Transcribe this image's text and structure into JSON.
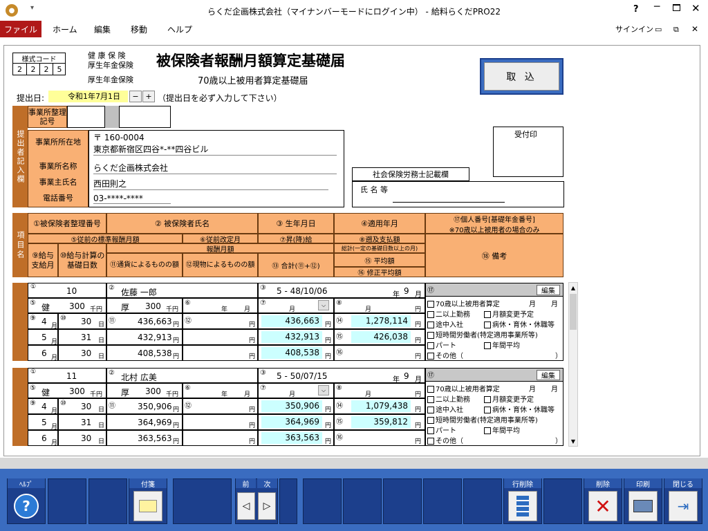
{
  "window": {
    "title": "らくだ企画株式会社（マイナンバーモードにログイン中） - 給料らくだPRO22",
    "signin": "サインイン",
    "help_btn": "?"
  },
  "menu": {
    "file": "ファイル",
    "home": "ホーム",
    "edit": "編集",
    "move": "移動",
    "help": "ヘルプ"
  },
  "form": {
    "format_code_label": "様式コード",
    "format_code": [
      "2",
      "2",
      "2",
      "5"
    ],
    "ins_types": [
      "健 康 保 険",
      "厚生年金保険",
      "厚生年金保険"
    ],
    "title": "被保険者報酬月額算定基礎届",
    "subtitle": "70歳以上被用者算定基礎届",
    "import_btn": "取 込",
    "submit_label": "提出日:",
    "submit_date": "令和1年7月1日",
    "minus": "−",
    "plus": "+",
    "submit_note": "（提出日を必ず入力して下さい）",
    "sidebar_text": "提出者記入欄",
    "office_id_label": "事業所整理記号",
    "addr_label": "事業所所在地",
    "zip": "〒 160-0004",
    "address": "東京都新宿区四谷*-**四谷ビル",
    "name_label": "事業所名称",
    "company": "らくだ企画株式会社",
    "owner_label": "事業主氏名",
    "owner": "西田則之",
    "phone_label": "電話番号",
    "phone": "03-****-****",
    "receipt_label": "受付印",
    "sharoushi_label": "社会保険労務士記載欄",
    "sharoushi_name": "氏 名 等"
  },
  "header": {
    "side": "項目名",
    "h1": "①被保険者整理番号",
    "h2": "② 被保険者氏名",
    "h3": "③ 生年月日",
    "h4": "④適用年月",
    "h17": "⑰個人番号[基礎年金番号]",
    "h17b": "※70歳以上被用者の場合のみ",
    "h5": "⑤従前の標準報酬月額",
    "h6": "⑥従前改定月",
    "h7": "⑦昇(降)給",
    "h8": "⑧遡及支払額",
    "h9": "⑨給与支給月",
    "h10": "⑩給与計算の基礎日数",
    "hpay": "報酬月額",
    "h11": "⑪通貨によるものの額",
    "h12": "⑫現物によるものの額",
    "h13": "⑬ 合計(⑪+⑫)",
    "h14": "総計(一定の基礎日数以上の月)",
    "h15": "⑮ 平均額",
    "h16": "⑯ 修正平均額",
    "h18": "⑱ 備考"
  },
  "employees": [
    {
      "no": "10",
      "name": "佐藤 一郎",
      "birth": "5 - 48/10/06",
      "apply_year": "年",
      "apply_month": "9",
      "edit": "編集",
      "ken": "健",
      "ken_val": "300",
      "kou": "厚",
      "kou_val": "300",
      "sen": "千円",
      "months": [
        {
          "m": "4",
          "d": "30",
          "cur": "436,663",
          "total": "436,663"
        },
        {
          "m": "5",
          "d": "31",
          "cur": "432,913",
          "total": "432,913"
        },
        {
          "m": "6",
          "d": "30",
          "cur": "408,538",
          "total": "408,538"
        }
      ],
      "sum": "1,278,114",
      "avg": "426,038"
    },
    {
      "no": "11",
      "name": "北村 広美",
      "birth": "5 - 50/07/15",
      "apply_year": "年",
      "apply_month": "9",
      "edit": "編集",
      "ken": "健",
      "ken_val": "300",
      "kou": "厚",
      "kou_val": "300",
      "sen": "千円",
      "months": [
        {
          "m": "4",
          "d": "30",
          "cur": "350,906",
          "total": "350,906"
        },
        {
          "m": "5",
          "d": "31",
          "cur": "364,969",
          "total": "364,969"
        },
        {
          "m": "6",
          "d": "30",
          "cur": "363,563",
          "total": "363,563"
        }
      ],
      "sum": "1,079,438",
      "avg": "359,812"
    }
  ],
  "remarks": {
    "r1": "70歳以上被用者算定",
    "r1b": "月",
    "r1c": "月",
    "r2": "二以上勤務",
    "r3": "月額変更予定",
    "r4": "途中入社",
    "r5": "病休・育休・休職等",
    "r6": "短時間労働者(特定適用事業所等)",
    "r7": "パート",
    "r8": "年間平均",
    "r9": "その他（",
    "r9b": "）"
  },
  "units": {
    "year": "年",
    "month": "月",
    "yen": "円",
    "day": "日",
    "circ": [
      "①",
      "②",
      "③",
      "⑤",
      "⑥",
      "⑦",
      "⑧",
      "⑨",
      "⑩",
      "⑪",
      "⑫",
      "⑭",
      "⑮",
      "⑯",
      "⑰"
    ]
  },
  "toolbar": {
    "help": "ﾍﾙﾌﾟ",
    "sticky": "付箋",
    "prev": "前",
    "next": "次",
    "rowdel": "行削除",
    "delete": "削除",
    "print": "印刷",
    "close": "閉じる",
    "help_icon": "?"
  }
}
